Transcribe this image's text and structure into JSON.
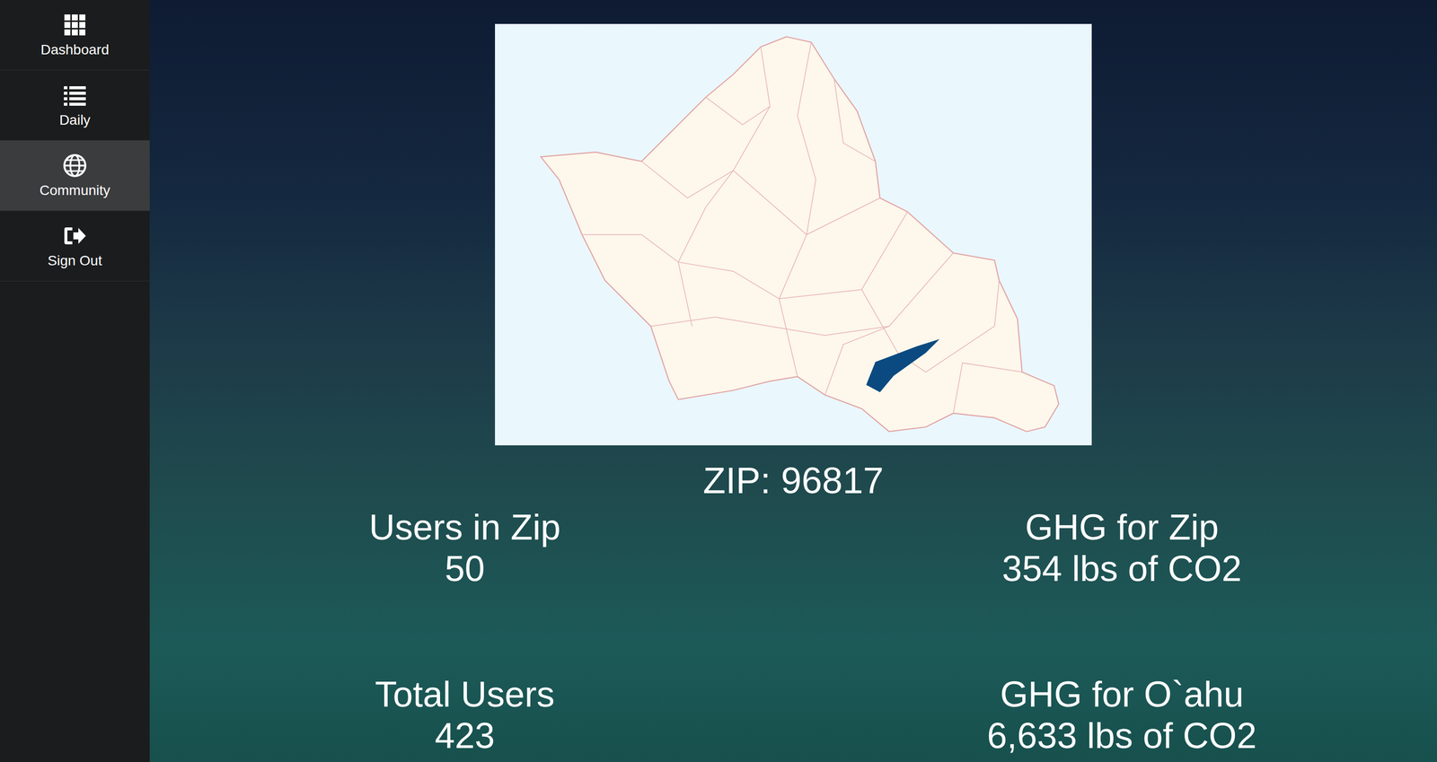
{
  "sidebar": {
    "items": [
      {
        "label": "Dashboard",
        "selected": false
      },
      {
        "label": "Daily",
        "selected": false
      },
      {
        "label": "Community",
        "selected": true
      },
      {
        "label": "Sign Out",
        "selected": false
      }
    ]
  },
  "zip": {
    "label": "ZIP: 96817"
  },
  "stats": [
    {
      "label": "Users in Zip",
      "value": "50"
    },
    {
      "label": "GHG for Zip",
      "value": "354 lbs of CO2"
    },
    {
      "label": "Total Users",
      "value": "423"
    },
    {
      "label": "GHG for O`ahu",
      "value": "6,633 lbs of CO2"
    }
  ]
}
